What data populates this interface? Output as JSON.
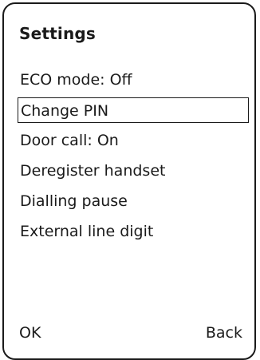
{
  "title": "Settings",
  "menu": [
    {
      "label": "ECO mode: Off",
      "selected": false
    },
    {
      "label": "Change PIN",
      "selected": true
    },
    {
      "label": "Door call: On",
      "selected": false
    },
    {
      "label": "Deregister handset",
      "selected": false
    },
    {
      "label": "Dialling pause",
      "selected": false
    },
    {
      "label": "External line digit",
      "selected": false
    }
  ],
  "softkeys": {
    "left": "OK",
    "right": "Back"
  }
}
